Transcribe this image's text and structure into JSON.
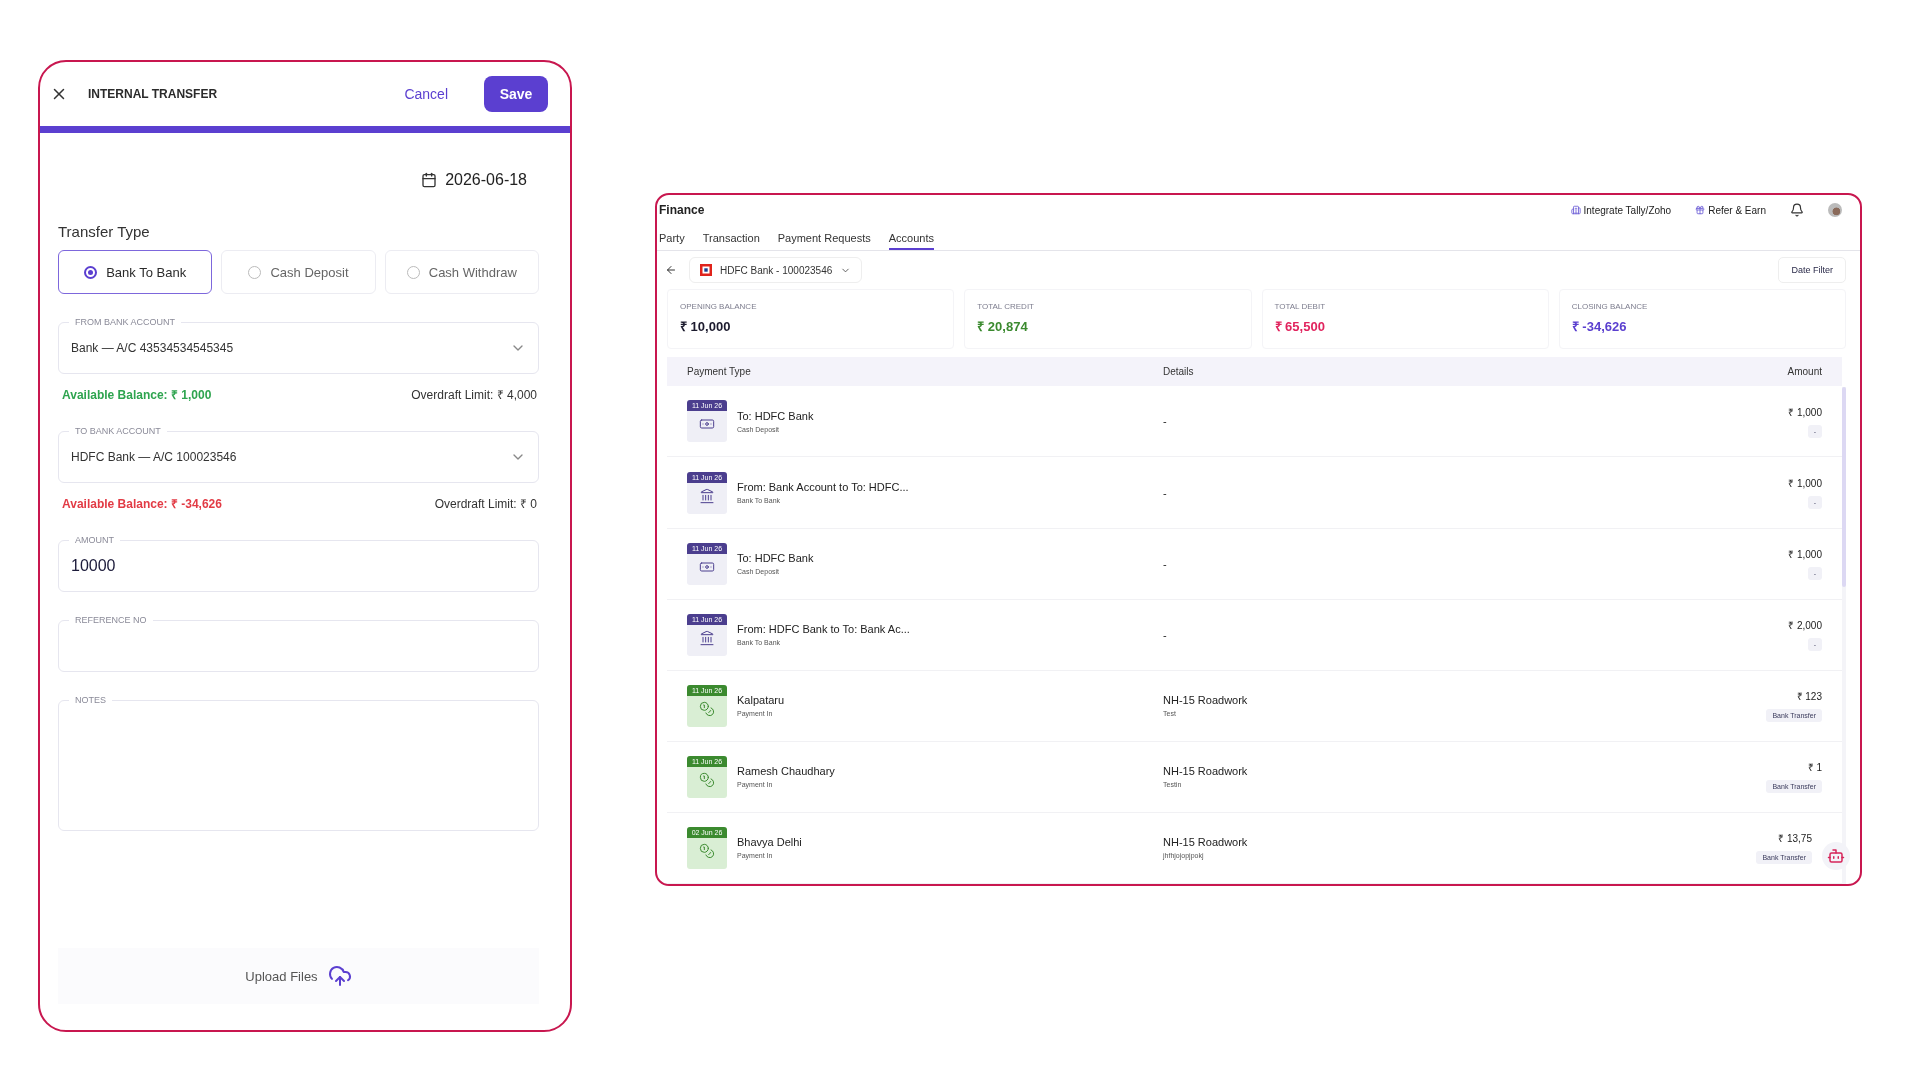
{
  "transfer_form": {
    "title": "INTERNAL TRANSFER",
    "cancel": "Cancel",
    "save": "Save",
    "date": "2026-06-18",
    "transfer_type_label": "Transfer Type",
    "transfer_types": [
      {
        "label": "Bank To Bank",
        "selected": true
      },
      {
        "label": "Cash Deposit",
        "selected": false
      },
      {
        "label": "Cash Withdraw",
        "selected": false
      }
    ],
    "from_account": {
      "label": "FROM BANK ACCOUNT",
      "value": "Bank — A/C 43534534545345"
    },
    "from_balance": {
      "kind": "positive",
      "available": "Available Balance: ₹ 1,000",
      "overdraft": "Overdraft Limit: ₹ 4,000"
    },
    "to_account": {
      "label": "TO BANK ACCOUNT",
      "value": "HDFC Bank — A/C 100023546"
    },
    "to_balance": {
      "kind": "negative",
      "available": "Available Balance: ₹ -34,626",
      "overdraft": "Overdraft Limit: ₹ 0"
    },
    "amount": {
      "label": "AMOUNT",
      "value": "10000"
    },
    "reference": {
      "label": "REFERENCE NO"
    },
    "notes": {
      "label": "NOTES"
    },
    "upload": "Upload Files"
  },
  "finance": {
    "title": "Finance",
    "header_links": [
      {
        "label": "Integrate Tally/Zoho",
        "kind": "integrate"
      },
      {
        "label": "Refer & Earn",
        "kind": "refer"
      }
    ],
    "tabs": [
      {
        "label": "Party",
        "selected": false
      },
      {
        "label": "Transaction",
        "selected": false
      },
      {
        "label": "Payment Requests",
        "selected": false
      },
      {
        "label": "Accounts",
        "selected": true
      }
    ],
    "account_selector": "HDFC Bank - 100023546",
    "date_filter": "Date Filter",
    "summary": [
      {
        "label": "OPENING BALANCE",
        "value": "₹ 10,000",
        "color": "#1c1b2e"
      },
      {
        "label": "TOTAL CREDIT",
        "value": "₹ 20,874",
        "color": "#3b8a2f"
      },
      {
        "label": "TOTAL DEBIT",
        "value": "₹ 65,500",
        "color": "#e1245e"
      },
      {
        "label": "CLOSING BALANCE",
        "value": "₹ -34,626",
        "color": "#5a3fcf"
      }
    ],
    "table": {
      "columns": [
        "Payment Type",
        "Details",
        "Amount"
      ],
      "rows": [
        {
          "kind": "cash_deposit",
          "date": "11 Jun 26",
          "title": "To: HDFC Bank",
          "subtitle": "Cash Deposit",
          "details": {
            "title": "-"
          },
          "amount": "₹ 1,000",
          "tag": "-"
        },
        {
          "kind": "bank_to_bank",
          "date": "11 Jun 26",
          "title": "From: Bank Account to To: HDFC...",
          "subtitle": "Bank To Bank",
          "details": {
            "title": "-"
          },
          "amount": "₹ 1,000",
          "tag": "-"
        },
        {
          "kind": "cash_deposit",
          "date": "11 Jun 26",
          "title": "To: HDFC Bank",
          "subtitle": "Cash Deposit",
          "details": {
            "title": "-"
          },
          "amount": "₹ 1,000",
          "tag": "-"
        },
        {
          "kind": "bank_to_bank",
          "date": "11 Jun 26",
          "title": "From: HDFC Bank to To: Bank Ac...",
          "subtitle": "Bank To Bank",
          "details": {
            "title": "-"
          },
          "amount": "₹ 2,000",
          "tag": "-"
        },
        {
          "kind": "payment_in",
          "date": "11 Jun 26",
          "title": "Kalpataru",
          "subtitle": "Payment In",
          "details": {
            "title": "NH-15 Roadwork",
            "note": "Test"
          },
          "amount": "₹ 123",
          "tag": "Bank Transfer"
        },
        {
          "kind": "payment_in",
          "date": "11 Jun 26",
          "title": "Ramesh Chaudhary",
          "subtitle": "Payment In",
          "details": {
            "title": "NH-15 Roadwork",
            "note": "Testin"
          },
          "amount": "₹ 1",
          "tag": "Bank Transfer"
        },
        {
          "kind": "payment_in",
          "date": "02 Jun 26",
          "title": "Bhavya Delhi",
          "subtitle": "Payment In",
          "details": {
            "title": "NH-15 Roadwork",
            "note": "jhfhjojopjpokj"
          },
          "amount": "₹ 13,75",
          "tag": "Bank Transfer"
        }
      ]
    }
  }
}
